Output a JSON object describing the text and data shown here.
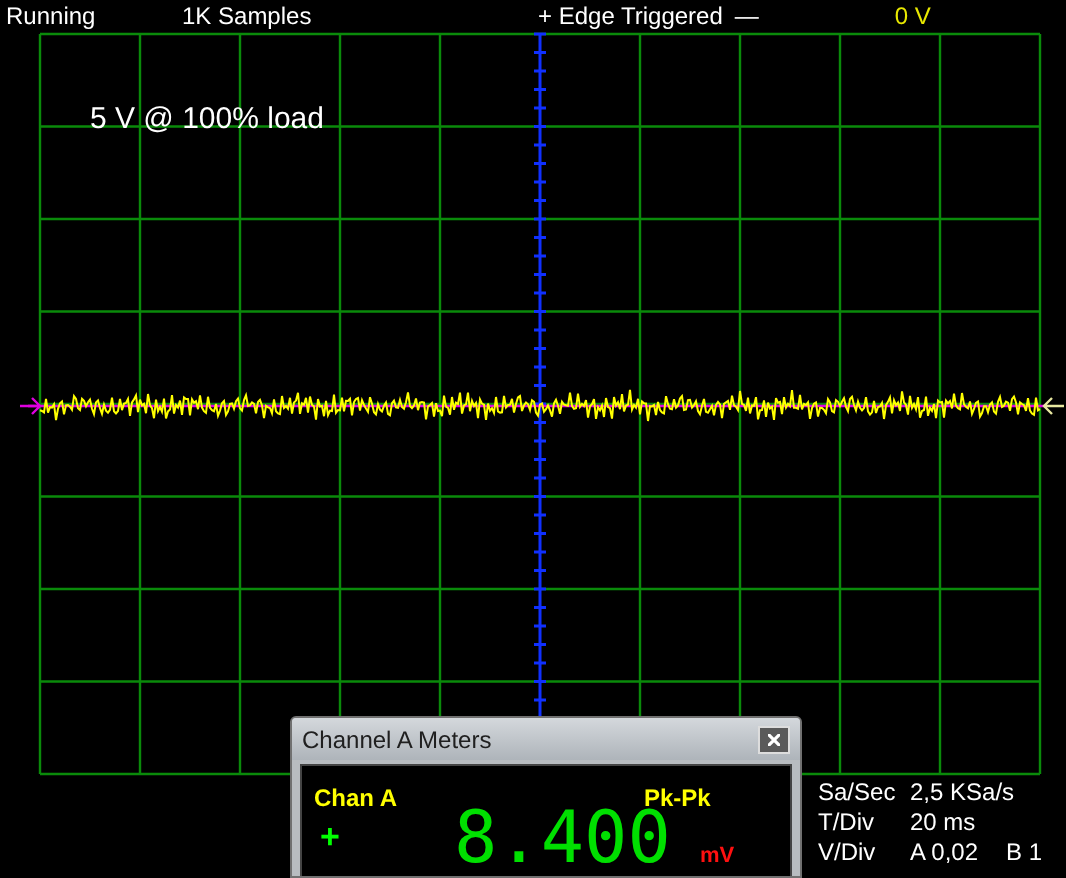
{
  "status_bar": {
    "state": "Running",
    "samples": "1K Samples",
    "trigger": "+ Edge Triggered",
    "trigger_mark": "—",
    "trigger_level": "0 V"
  },
  "scope": {
    "label": "5 V @ 100% load"
  },
  "meter_window": {
    "title": "Channel A Meters",
    "channel": "Chan A",
    "measure": "Pk-Pk",
    "polarity": "+",
    "reading": "8.400",
    "unit": "mV"
  },
  "readouts": [
    {
      "label": "Sa/Sec",
      "values": [
        "2,5 KSa/s"
      ]
    },
    {
      "label": "T/Div",
      "values": [
        "20 ms"
      ]
    },
    {
      "label": "V/Div",
      "values": [
        "A 0,02",
        "B 1"
      ]
    }
  ]
}
